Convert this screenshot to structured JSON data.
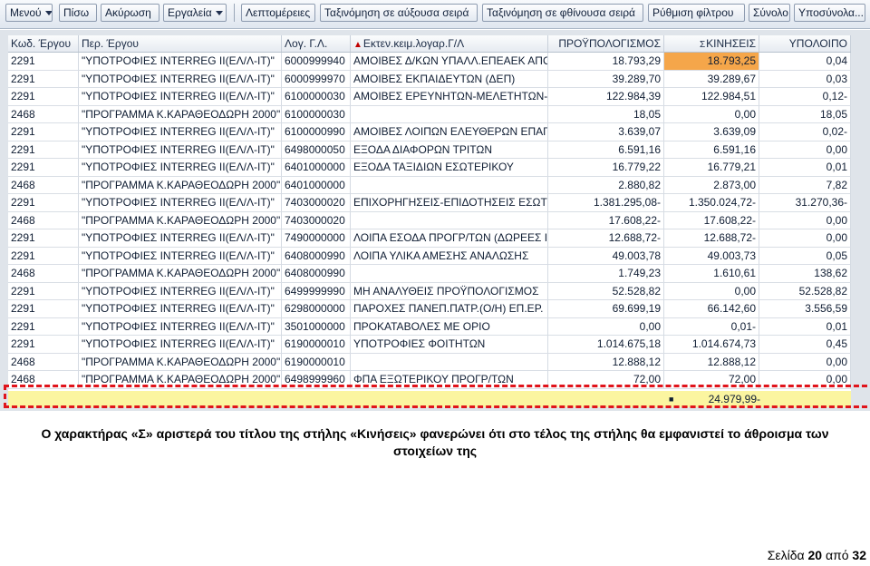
{
  "toolbar": {
    "buttons": [
      {
        "label": "Μενού",
        "dropdown": true
      },
      {
        "label": "Πίσω",
        "dropdown": false
      },
      {
        "label": "Ακύρωση",
        "dropdown": false
      },
      {
        "label": "Εργαλεία",
        "dropdown": true
      },
      {
        "label": "Λεπτομέρειες",
        "dropdown": false
      },
      {
        "label": "Ταξινόμηση σε αύξουσα σειρά",
        "dropdown": false
      },
      {
        "label": "Ταξινόμηση σε φθίνουσα σειρά",
        "dropdown": false
      },
      {
        "label": "Ρύθμιση φίλτρου",
        "dropdown": false
      },
      {
        "label": "Σύνολο",
        "dropdown": false
      },
      {
        "label": "Υποσύνολα...",
        "dropdown": false
      }
    ]
  },
  "grid": {
    "columns": [
      {
        "label": "Κωδ. Έργου"
      },
      {
        "label": "Περ. Έργου"
      },
      {
        "label": "Λογ. Γ.Λ."
      },
      {
        "label": "Εκτεν.κειμ.λογαρ.Γ/Λ",
        "sorted": true
      },
      {
        "label": "ΠΡΟΫΠΟΛΟΓΙΣΜΟΣ"
      },
      {
        "label": "ΚΙΝΗΣΕΙΣ",
        "sum": true,
        "sum_symbol": "Σ"
      },
      {
        "label": "ΥΠΟΛΟΙΠΟ"
      }
    ],
    "rows": [
      [
        "2291",
        "\"ΥΠΟΤΡΟΦΙΕΣ INTERREG II(ΕΛ/Λ-ΙΤ)\"",
        "6000999940",
        "ΑΜΟΙΒΕΣ Δ/ΚΩΝ ΥΠΑΛΛ.ΕΠΕΑΕΚ ΑΠΟ",
        "18.793,29",
        "18.793,25",
        "0,04"
      ],
      [
        "2291",
        "\"ΥΠΟΤΡΟΦΙΕΣ INTERREG II(ΕΛ/Λ-ΙΤ)\"",
        "6000999970",
        "ΑΜΟΙΒΕΣ ΕΚΠΑΙΔΕΥΤΩΝ (ΔΕΠ)",
        "39.289,70",
        "39.289,67",
        "0,03"
      ],
      [
        "2291",
        "\"ΥΠΟΤΡΟΦΙΕΣ INTERREG II(ΕΛ/Λ-ΙΤ)\"",
        "6100000030",
        "ΑΜΟΙΒΕΣ ΕΡΕΥΝΗΤΩΝ-ΜΕΛΕΤΗΤΩΝ-",
        "122.984,39",
        "122.984,51",
        "0,12-"
      ],
      [
        "2468",
        "\"ΠΡΟΓΡΑΜΜΑ Κ.ΚΑΡΑΘΕΟΔΩΡΗ 2000\"",
        "6100000030",
        "",
        "18,05",
        "0,00",
        "18,05"
      ],
      [
        "2291",
        "\"ΥΠΟΤΡΟΦΙΕΣ INTERREG II(ΕΛ/Λ-ΙΤ)\"",
        "6100000990",
        "ΑΜΟΙΒΕΣ ΛΟΙΠΩΝ ΕΛΕΥΘΕΡΩΝ ΕΠΑΓ",
        "3.639,07",
        "3.639,09",
        "0,02-"
      ],
      [
        "2291",
        "\"ΥΠΟΤΡΟΦΙΕΣ INTERREG II(ΕΛ/Λ-ΙΤ)\"",
        "6498000050",
        "ΕΞΟΔΑ ΔΙΑΦΟΡΩΝ ΤΡΙΤΩΝ",
        "6.591,16",
        "6.591,16",
        "0,00"
      ],
      [
        "2291",
        "\"ΥΠΟΤΡΟΦΙΕΣ INTERREG II(ΕΛ/Λ-ΙΤ)\"",
        "6401000000",
        "ΕΞΟΔΑ ΤΑΞΙΔΙΩΝ ΕΣΩΤΕΡΙΚΟΥ",
        "16.779,22",
        "16.779,21",
        "0,01"
      ],
      [
        "2468",
        "\"ΠΡΟΓΡΑΜΜΑ Κ.ΚΑΡΑΘΕΟΔΩΡΗ 2000\"",
        "6401000000",
        "",
        "2.880,82",
        "2.873,00",
        "7,82"
      ],
      [
        "2291",
        "\"ΥΠΟΤΡΟΦΙΕΣ INTERREG II(ΕΛ/Λ-ΙΤ)\"",
        "7403000020",
        "ΕΠΙΧΟΡΗΓΗΣΕΙΣ-ΕΠΙΔΟΤΗΣΕΙΣ ΕΣΩΤ",
        "1.381.295,08-",
        "1.350.024,72-",
        "31.270,36-"
      ],
      [
        "2468",
        "\"ΠΡΟΓΡΑΜΜΑ Κ.ΚΑΡΑΘΕΟΔΩΡΗ 2000\"",
        "7403000020",
        "",
        "17.608,22-",
        "17.608,22-",
        "0,00"
      ],
      [
        "2291",
        "\"ΥΠΟΤΡΟΦΙΕΣ INTERREG II(ΕΛ/Λ-ΙΤ)\"",
        "7490000000",
        "ΛΟΙΠΑ ΕΣΟΔΑ ΠΡΟΓΡ/ΤΩΝ (ΔΩΡΕΕΣ Ι",
        "12.688,72-",
        "12.688,72-",
        "0,00"
      ],
      [
        "2291",
        "\"ΥΠΟΤΡΟΦΙΕΣ INTERREG II(ΕΛ/Λ-ΙΤ)\"",
        "6408000990",
        "ΛΟΙΠΑ ΥΛΙΚΑ ΑΜΕΣΗΣ ΑΝΑΛΩΣΗΣ",
        "49.003,78",
        "49.003,73",
        "0,05"
      ],
      [
        "2468",
        "\"ΠΡΟΓΡΑΜΜΑ Κ.ΚΑΡΑΘΕΟΔΩΡΗ 2000\"",
        "6408000990",
        "",
        "1.749,23",
        "1.610,61",
        "138,62"
      ],
      [
        "2291",
        "\"ΥΠΟΤΡΟΦΙΕΣ INTERREG II(ΕΛ/Λ-ΙΤ)\"",
        "6499999990",
        "ΜΗ ΑΝΑΛΥΘΕΙΣ ΠΡΟΫΠΟΛΟΓΙΣΜΟΣ",
        "52.528,82",
        "0,00",
        "52.528,82"
      ],
      [
        "2291",
        "\"ΥΠΟΤΡΟΦΙΕΣ INTERREG II(ΕΛ/Λ-ΙΤ)\"",
        "6298000000",
        "ΠΑΡΟΧΕΣ ΠΑΝΕΠ.ΠΑΤΡ.(Ο/Η) ΕΠ.ΕΡ.",
        "69.699,19",
        "66.142,60",
        "3.556,59"
      ],
      [
        "2291",
        "\"ΥΠΟΤΡΟΦΙΕΣ INTERREG II(ΕΛ/Λ-ΙΤ)\"",
        "3501000000",
        "ΠΡΟΚΑΤΑΒΟΛΕΣ ΜΕ ΟΡΙΟ",
        "0,00",
        "0,01-",
        "0,01"
      ],
      [
        "2291",
        "\"ΥΠΟΤΡΟΦΙΕΣ INTERREG II(ΕΛ/Λ-ΙΤ)\"",
        "6190000010",
        "ΥΠΟΤΡΟΦΙΕΣ ΦΟΙΤΗΤΩΝ",
        "1.014.675,18",
        "1.014.674,73",
        "0,45"
      ],
      [
        "2468",
        "\"ΠΡΟΓΡΑΜΜΑ Κ.ΚΑΡΑΘΕΟΔΩΡΗ 2000\"",
        "6190000010",
        "",
        "12.888,12",
        "12.888,12",
        "0,00"
      ],
      [
        "2468",
        "\"ΠΡΟΓΡΑΜΜΑ Κ.ΚΑΡΑΘΕΟΔΩΡΗ 2000\"",
        "6498999960",
        "ΦΠΑ ΕΞΩΤΕΡΙΚΟΥ ΠΡΟΓΡ/ΤΩΝ",
        "72,00",
        "72,00",
        "0,00"
      ]
    ],
    "highlight": {
      "row": 0,
      "col": 5,
      "color": "#f5a64a"
    },
    "total": {
      "marker": "■",
      "value": "24.979,99-",
      "color": "#fbf5a0"
    },
    "emphasis_color": "#e0141b"
  },
  "caption": "Ο χαρακτήρας «Σ» αριστερά του τίτλου της στήλης «Κινήσεις» φανερώνει ότι στο τέλος της στήλης θα εμφανιστεί το άθροισμα των στοιχείων της",
  "footer": {
    "prefix": "Σελίδα",
    "page": "20",
    "middle": "από",
    "total": "32"
  }
}
